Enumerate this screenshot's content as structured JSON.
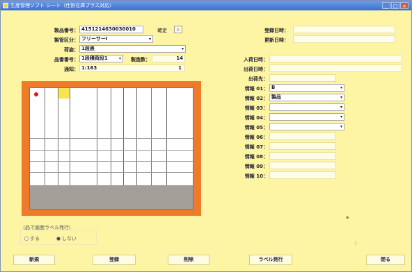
{
  "titlebar": {
    "title": "生産管理ソフト シート（仕掛在庫プラス対応）",
    "minimize": "_",
    "maximize": "□",
    "close": "×"
  },
  "left_form": {
    "field1": {
      "label": "製品番号：",
      "value": "4151214630030010",
      "suffix": "確定"
    },
    "field2": {
      "label": "製管区分：",
      "value": "フリーサーⅠ"
    },
    "field3": {
      "label": "荷姿：",
      "value": "1段表"
    },
    "field4": {
      "label": "品番番号：",
      "value": "1段積荷段1",
      "extra_label": "製造数：",
      "extra_value": "14"
    },
    "field5": {
      "label": "通知：",
      "value": "1:163",
      "extra_value": "1"
    }
  },
  "right_form": {
    "created_date": {
      "label": "登録日時：",
      "value": ""
    },
    "updated_date": {
      "label": "更新日時：",
      "value": ""
    },
    "arrival_date": {
      "label": "入荷日時：",
      "value": ""
    },
    "shipment_date": {
      "label": "出荷日時：",
      "value": ""
    },
    "shipment_dest": {
      "label": "出荷先：",
      "value": ""
    },
    "info_fields": [
      {
        "label": "情報 01：",
        "value": "B",
        "dropdown": true
      },
      {
        "label": "情報 02：",
        "value": "製品",
        "dropdown": true
      },
      {
        "label": "情報 03：",
        "value": "",
        "dropdown": true
      },
      {
        "label": "情報 04：",
        "value": "",
        "dropdown": true
      },
      {
        "label": "情報 05：",
        "value": "",
        "dropdown": true
      },
      {
        "label": "情報 06：",
        "value": "",
        "dropdown": false
      },
      {
        "label": "情報 07：",
        "value": "",
        "dropdown": false
      },
      {
        "label": "情報 08：",
        "value": "",
        "dropdown": false
      },
      {
        "label": "情報 09：",
        "value": "",
        "dropdown": false
      },
      {
        "label": "情報 10：",
        "value": "",
        "dropdown": false
      }
    ]
  },
  "label_print": {
    "group_label": "（品で画面ラベル発行）",
    "option_yes": "する",
    "option_no": "しない",
    "selected": "no"
  },
  "buttons": {
    "new": "新規",
    "register": "登録",
    "delete": "削除",
    "label_issue": "ラベル発行",
    "close": "閉る"
  }
}
